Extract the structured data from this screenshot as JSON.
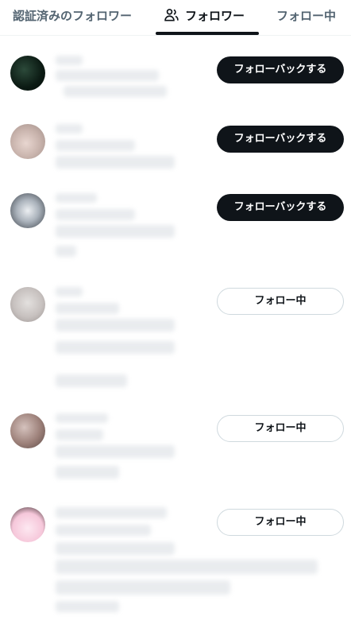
{
  "tabs": {
    "verified": "認証済みのフォロワー",
    "followers": "フォロワー",
    "following": "フォロー中",
    "followers_icon": "people-icon"
  },
  "rows": [
    {
      "button": "フォローバックする",
      "button_style": "dark"
    },
    {
      "button": "フォローバックする",
      "button_style": "dark"
    },
    {
      "button": "フォローバックする",
      "button_style": "dark"
    },
    {
      "button": "フォロー中",
      "button_style": "light"
    },
    {
      "button": "フォロー中",
      "button_style": "light"
    },
    {
      "button": "フォロー中",
      "button_style": "light"
    }
  ],
  "colors": {
    "primary_dark": "#0f1419",
    "secondary_text": "#536471",
    "border": "#cfd9de"
  }
}
